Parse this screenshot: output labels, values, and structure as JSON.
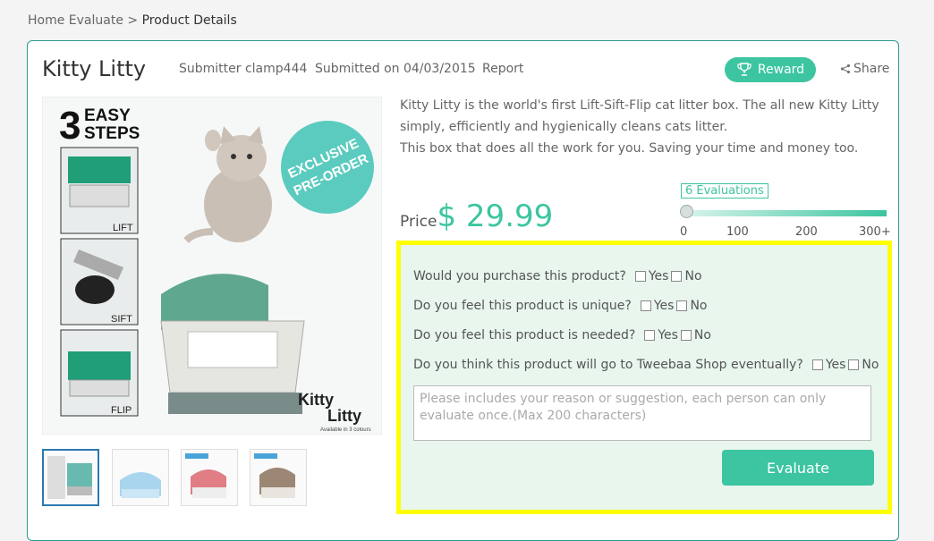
{
  "breadcrumb": {
    "home": "Home",
    "evaluate": "Evaluate",
    "separator": ">",
    "current": "Product Details"
  },
  "product": {
    "title": "Kitty Litty",
    "submitter": "Submitter clamp444",
    "submitted_on": "Submitted on 04/03/2015",
    "report": "Report",
    "reward": "Reward",
    "share": "Share",
    "description": [
      "Kitty Litty is the world's first Lift-Sift-Flip cat litter box. The all new Kitty Litty simply, efficiently and hygienically cleans cats litter.",
      "This box that does all the work for you. Saving your time and money too."
    ],
    "price_label": "Price",
    "price": "$ 29.99"
  },
  "image": {
    "steps_number": "3",
    "steps_text": [
      "EASY",
      "STEPS"
    ],
    "step_labels": [
      "LIFT",
      "SIFT",
      "FLIP"
    ],
    "badge": [
      "EXCLUSIVE",
      "PRE-ORDER"
    ],
    "brand": [
      "Kitty",
      "Litty"
    ],
    "available": "Available in 3 colours"
  },
  "evaluations": {
    "badge": "6 Evaluations",
    "count": 6,
    "ticks": [
      "0",
      "100",
      "200",
      "300+"
    ]
  },
  "form": {
    "questions": [
      {
        "text": "Would you purchase this product?",
        "yes": "Yes",
        "no": "No"
      },
      {
        "text": "Do you feel this product is unique?",
        "yes": "Yes",
        "no": "No"
      },
      {
        "text": "Do you feel this product is needed?",
        "yes": "Yes",
        "no": "No"
      },
      {
        "text": "Do you think this product will go to Tweebaa Shop eventually?",
        "yes": "Yes",
        "no": "No"
      }
    ],
    "placeholder": "Please includes your reason or suggestion, each person can only evaluate once.(Max 200 characters)",
    "submit": "Evaluate"
  },
  "colors": {
    "accent": "#3cc5a0",
    "highlight": "#ffff00",
    "border": "#2a9d8f"
  },
  "icons": {
    "reward": "trophy-icon",
    "share": "share-icon"
  }
}
